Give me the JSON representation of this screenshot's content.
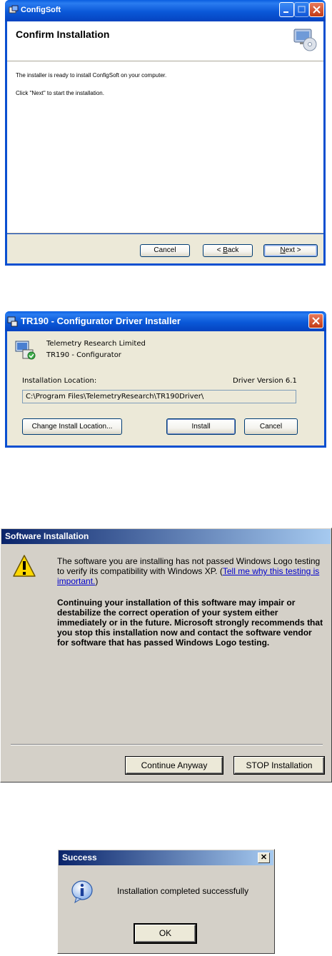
{
  "dialog1": {
    "title": "ConfigSoft",
    "heading": "Confirm Installation",
    "line1": "The installer is ready to install ConfigSoft on your computer.",
    "line2": "Click \"Next\" to start the installation.",
    "cancel": "Cancel",
    "back_pre": "< ",
    "back_key": "B",
    "back_post": "ack",
    "next_key": "N",
    "next_post": "ext >"
  },
  "dialog2": {
    "title": "TR190 - Configurator Driver Installer",
    "company": "Telemetry Research Limited",
    "product": "TR190 - Configurator",
    "location_label": "Installation Location:",
    "version": "Driver Version 6.1",
    "path": "C:\\Program Files\\TelemetryResearch\\TR190Driver\\",
    "change_btn": "Change Install Location...",
    "install_btn": "Install",
    "cancel_btn": "Cancel"
  },
  "dialog3": {
    "title": "Software Installation",
    "msg_pre": "The software you are installing has not passed Windows Logo testing to verify its compatibility with Windows XP. (",
    "link": "Tell me why this testing is important.",
    "msg_post": ")",
    "warning": "Continuing your installation of this software may impair or destabilize the correct operation of your system either immediately or in the future. Microsoft strongly recommends that you stop this installation now and contact the software vendor for software that has passed Windows Logo testing.",
    "continue_btn": "Continue Anyway",
    "stop_btn": "STOP Installation"
  },
  "dialog4": {
    "title": "Success",
    "message": "Installation completed successfully",
    "ok": "OK",
    "close_glyph": "✕"
  }
}
